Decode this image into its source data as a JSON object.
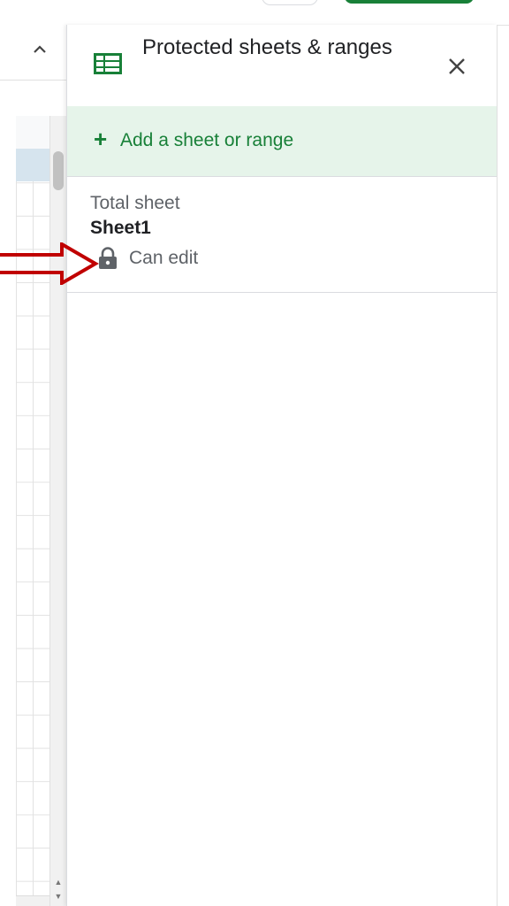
{
  "panel": {
    "title": "Protected sheets & ranges",
    "add_label": "Add a sheet or range",
    "add_icon": "plus-icon",
    "close_icon": "close-icon",
    "header_icon": "google-sheets-icon"
  },
  "protected_items": [
    {
      "description": "Total sheet",
      "range": "Sheet1",
      "permission": "Can edit",
      "icon": "lock-icon"
    }
  ],
  "colors": {
    "accent_green": "#188038",
    "add_bar_bg": "#e6f4ea",
    "annotation_arrow": "#c00000"
  }
}
